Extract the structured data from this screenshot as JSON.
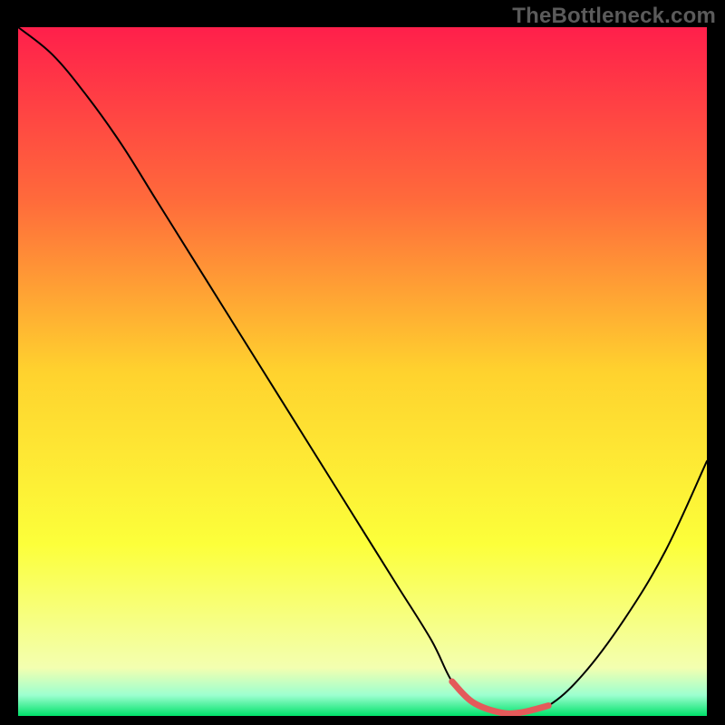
{
  "watermark": "TheBottleneck.com",
  "chart_data": {
    "type": "line",
    "title": "",
    "xlabel": "",
    "ylabel": "",
    "xlim": [
      0,
      100
    ],
    "ylim": [
      0,
      100
    ],
    "grid": false,
    "background_gradient": {
      "stops": [
        {
          "offset": 0.0,
          "color": "#ff1f4b"
        },
        {
          "offset": 0.25,
          "color": "#ff6a3b"
        },
        {
          "offset": 0.5,
          "color": "#ffd22e"
        },
        {
          "offset": 0.75,
          "color": "#fcff3a"
        },
        {
          "offset": 0.93,
          "color": "#f3ffb0"
        },
        {
          "offset": 0.97,
          "color": "#9cffd0"
        },
        {
          "offset": 1.0,
          "color": "#00e16a"
        }
      ]
    },
    "series": [
      {
        "name": "curve",
        "color": "#000000",
        "x": [
          0,
          5,
          10,
          15,
          20,
          25,
          30,
          35,
          40,
          45,
          50,
          55,
          60,
          63,
          66,
          70,
          73,
          77,
          82,
          88,
          94,
          100
        ],
        "y": [
          100,
          96,
          90,
          83,
          75,
          67,
          59,
          51,
          43,
          35,
          27,
          19,
          11,
          5,
          2,
          0.5,
          0.5,
          1.5,
          6,
          14,
          24,
          37
        ]
      },
      {
        "name": "highlight-segment",
        "color": "#e45a5a",
        "x": [
          63,
          66,
          70,
          73,
          77
        ],
        "y": [
          5,
          2,
          0.5,
          0.5,
          1.5
        ]
      }
    ]
  }
}
